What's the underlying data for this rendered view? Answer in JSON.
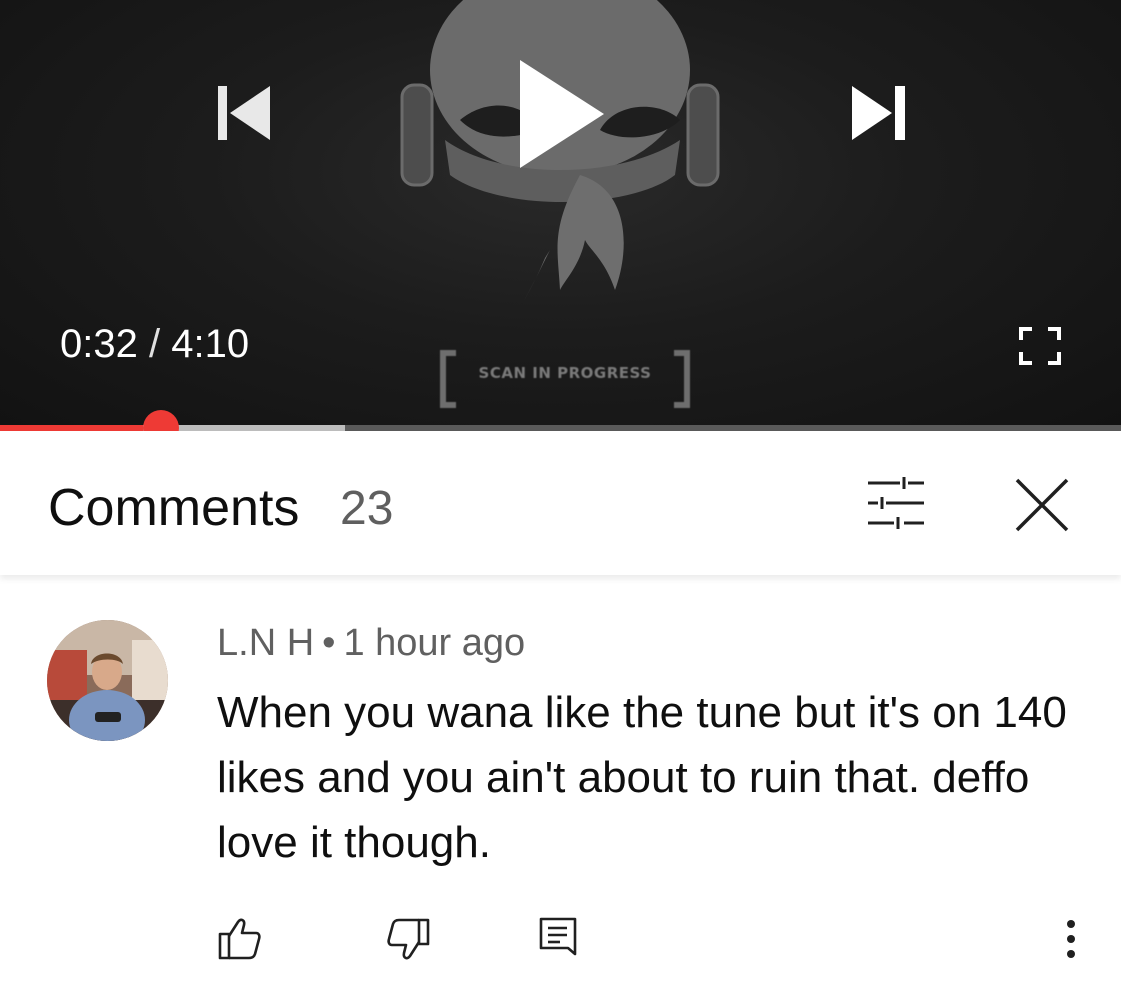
{
  "player": {
    "current_time": "0:32",
    "separator": "/",
    "duration": "4:10",
    "overlay_text": "SCAN IN PROGRESS",
    "progress_fraction": 0.128,
    "buffered_fraction": 0.308,
    "accent_color": "#ee3a35"
  },
  "comments": {
    "title": "Comments",
    "count": "23",
    "items": [
      {
        "author": "L.N H",
        "dot": "•",
        "time": "1 hour ago",
        "text": "When you wana like the tune but it's on 140 likes and you ain't about to ruin that. deffo love it though."
      }
    ]
  },
  "icons": {
    "prev": "skip-previous-icon",
    "play": "play-icon",
    "next": "skip-next-icon",
    "fullscreen": "fullscreen-icon",
    "filter": "sort-filter-icon",
    "close": "close-icon",
    "like": "thumbs-up-icon",
    "dislike": "thumbs-down-icon",
    "reply": "reply-comment-icon",
    "more": "more-vertical-icon"
  }
}
